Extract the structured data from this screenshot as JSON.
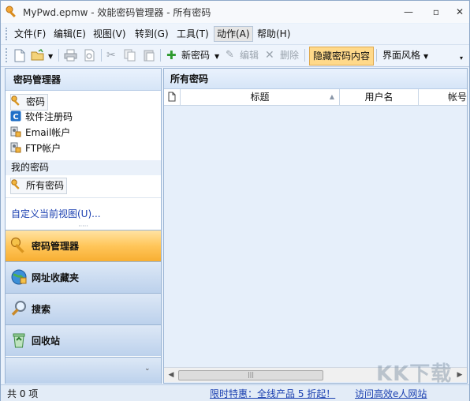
{
  "window": {
    "title": "MyPwd.epmw - 效能密码管理器 - 所有密码",
    "min_glyph": "—",
    "max_glyph": "▫",
    "close_glyph": "✕"
  },
  "menu": {
    "items": [
      "文件(F)",
      "编辑(E)",
      "视图(V)",
      "转到(G)",
      "工具(T)",
      "动作(A)",
      "帮助(H)"
    ],
    "active": "动作(A)"
  },
  "toolbar": {
    "new_password": "新密码",
    "edit": "编辑",
    "delete": "删除",
    "hide_content": "隐藏密码内容",
    "interface_style": "界面风格"
  },
  "left_panel": {
    "header": "密码管理器",
    "items": [
      "密码",
      "软件注册码",
      "Email帐户",
      "FTP帐户"
    ],
    "my_passwords_group": "我的密码",
    "all_passwords": "所有密码",
    "customize_link": "自定义当前视图(U)...",
    "big_buttons": [
      "密码管理器",
      "网址收藏夹",
      "搜索",
      "回收站"
    ],
    "active_big_button": "密码管理器"
  },
  "right_panel": {
    "header": "所有密码",
    "columns": [
      "标题",
      "用户名",
      "帐号"
    ]
  },
  "status": {
    "count": "共 0 项",
    "promo": "限时特惠：全线产品 5 折起！",
    "visit": "访问高效e人网站"
  },
  "watermark": "KK下载",
  "colors": {
    "accent_orange": "#ffc65a",
    "panel_blue": "#e6effa",
    "link_blue": "#1a3fb0"
  }
}
